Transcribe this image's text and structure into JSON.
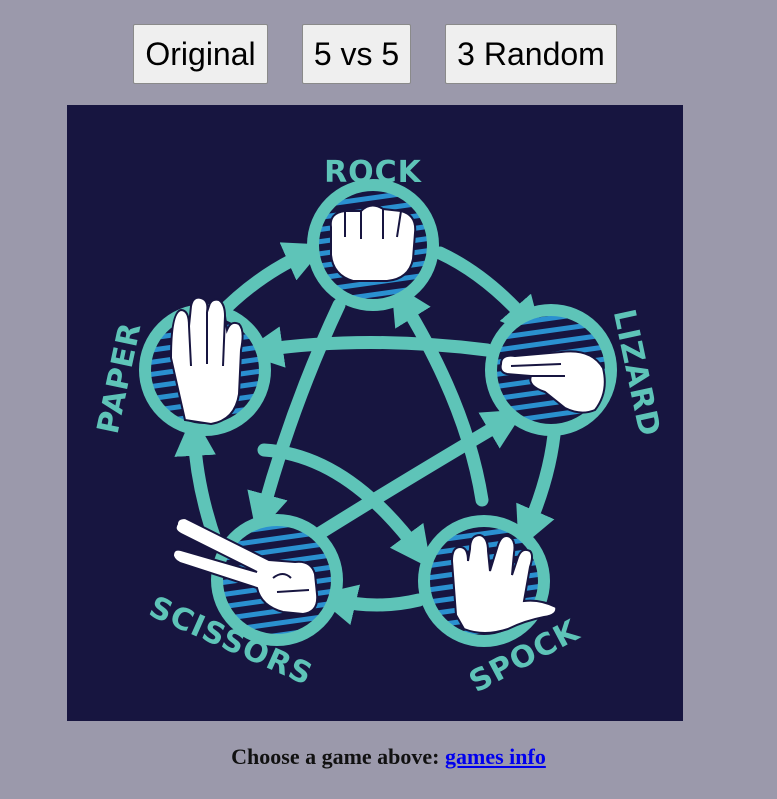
{
  "buttons": {
    "original": "Original",
    "five_vs_five": "5 vs 5",
    "three_random": "3 Random"
  },
  "board": {
    "labels": {
      "rock": "ROCK",
      "lizard": "LIZARD",
      "spock": "SPOCK",
      "scissors": "SCISSORS",
      "paper": "PAPER"
    },
    "colors": {
      "background": "#171540",
      "teal": "#5ec4b8",
      "stripe": "#2a90d0",
      "hand": "#ffffff"
    },
    "hands": [
      "rock-hand-icon",
      "lizard-hand-icon",
      "spock-hand-icon",
      "scissors-hand-icon",
      "paper-hand-icon"
    ]
  },
  "footer": {
    "text": "Choose a game above:",
    "link": "games info"
  }
}
